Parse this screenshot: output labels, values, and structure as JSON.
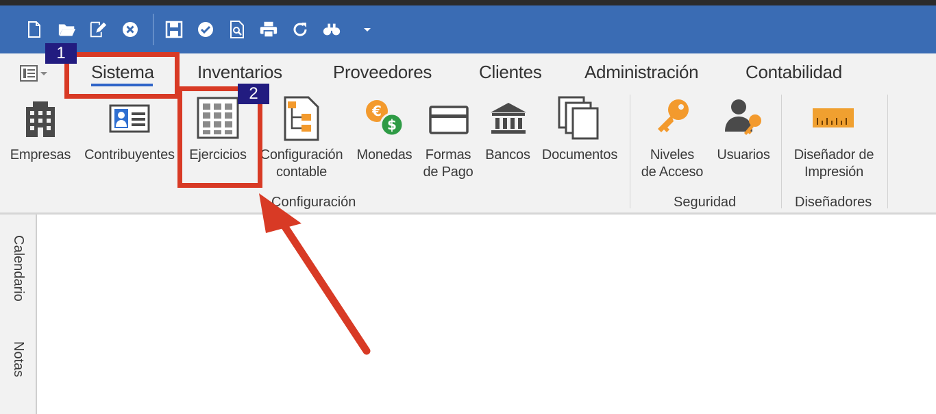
{
  "colors": {
    "titlebar": "#3a6cb4",
    "ribbon_bg": "#f2f2f2",
    "accent_underline": "#2f64c8",
    "callout_red": "#d83a25",
    "badge_bg": "#221c80",
    "icon_dark": "#4a4a4a",
    "icon_orange": "#f39a2d",
    "icon_green": "#2e9b45",
    "ruler_orange": "#f0a030"
  },
  "quick_access_toolbar": {
    "icons": [
      "new-document-icon",
      "open-folder-icon",
      "edit-document-icon",
      "close-circle-icon",
      "save-icon",
      "check-circle-icon",
      "print-preview-icon",
      "print-icon",
      "refresh-icon",
      "binoculars-icon",
      "dropdown-arrow-icon"
    ]
  },
  "tabs": [
    {
      "label": "Sistema",
      "active": true
    },
    {
      "label": "Inventarios"
    },
    {
      "label": "Proveedores"
    },
    {
      "label": "Clientes"
    },
    {
      "label": "Administración"
    },
    {
      "label": "Contabilidad"
    }
  ],
  "ribbon": {
    "buttons": [
      {
        "label": "Empresas",
        "icon": "building-icon"
      },
      {
        "label": "Contribuyentes",
        "icon": "id-card-icon"
      },
      {
        "label": "Ejercicios",
        "icon": "grid-calendar-icon"
      },
      {
        "label_line1": "Configuración",
        "label_line2": "contable",
        "icon": "accounting-tree-icon"
      },
      {
        "label": "Monedas",
        "icon": "currency-icon"
      },
      {
        "label_line1": "Formas",
        "label_line2": "de Pago",
        "icon": "credit-card-icon"
      },
      {
        "label": "Bancos",
        "icon": "bank-icon"
      },
      {
        "label": "Documentos",
        "icon": "documents-icon"
      },
      {
        "label_line1": "Niveles",
        "label_line2": "de Acceso",
        "icon": "key-icon"
      },
      {
        "label": "Usuarios",
        "icon": "user-key-icon"
      },
      {
        "label_line1": "Diseñador de",
        "label_line2": "Impresión",
        "icon": "ruler-icon"
      }
    ],
    "groups": [
      {
        "label": "Configuración"
      },
      {
        "label": "Seguridad"
      },
      {
        "label": "Diseñadores"
      }
    ]
  },
  "side_panel": {
    "tabs": [
      {
        "label": "Calendario"
      },
      {
        "label": "Notas"
      }
    ]
  },
  "annotations": {
    "badge_1": "1",
    "badge_2": "2"
  }
}
